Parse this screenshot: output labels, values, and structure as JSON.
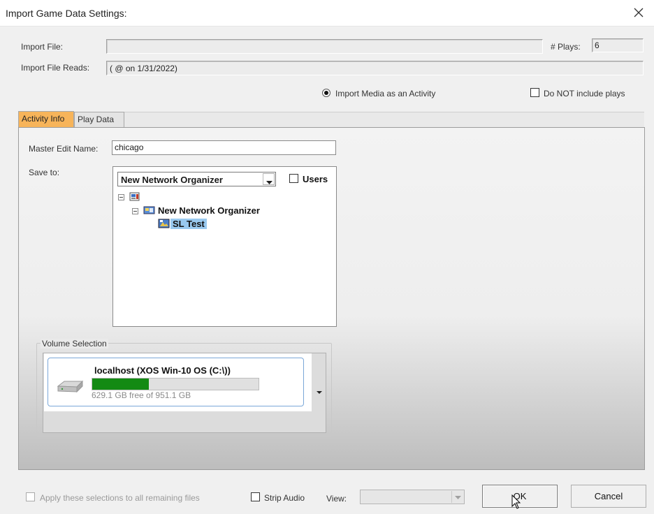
{
  "window": {
    "title": "Import Game Data Settings:",
    "close_icon": "close-icon"
  },
  "header": {
    "import_file_label": "Import File:",
    "import_file_value": "",
    "plays_label": "# Plays:",
    "plays_value": "6",
    "reads_label": "Import File Reads:",
    "reads_value": "( @  on 1/31/2022)"
  },
  "options": {
    "import_media_label": "Import Media as an Activity",
    "import_media_selected": true,
    "no_plays_label": "Do NOT include plays",
    "no_plays_checked": false
  },
  "tabs": [
    {
      "label": "Activity Info",
      "active": true
    },
    {
      "label": "Play Data",
      "active": false
    }
  ],
  "activity": {
    "master_edit_label": "Master Edit Name:",
    "master_edit_value": "chicago",
    "save_to_label": "Save to:",
    "organizer_combo_value": "New Network Organizer",
    "users_label": "Users",
    "users_checked": false,
    "tree": {
      "root_label": "",
      "child_label": "New Network Organizer",
      "leaf_label": "SL Test"
    }
  },
  "volume": {
    "group_label": "Volume Selection",
    "name": "localhost (XOS Win-10 OS (C:\\))",
    "free_text": "629.1 GB free of 951.1 GB",
    "used_fraction": 0.34,
    "bar_color": "#138a13"
  },
  "footer": {
    "apply_all_label": "Apply these selections to all remaining files",
    "strip_audio_label": "Strip Audio",
    "view_label": "View:",
    "view_value": "",
    "ok_label": "OK",
    "cancel_label": "Cancel"
  }
}
